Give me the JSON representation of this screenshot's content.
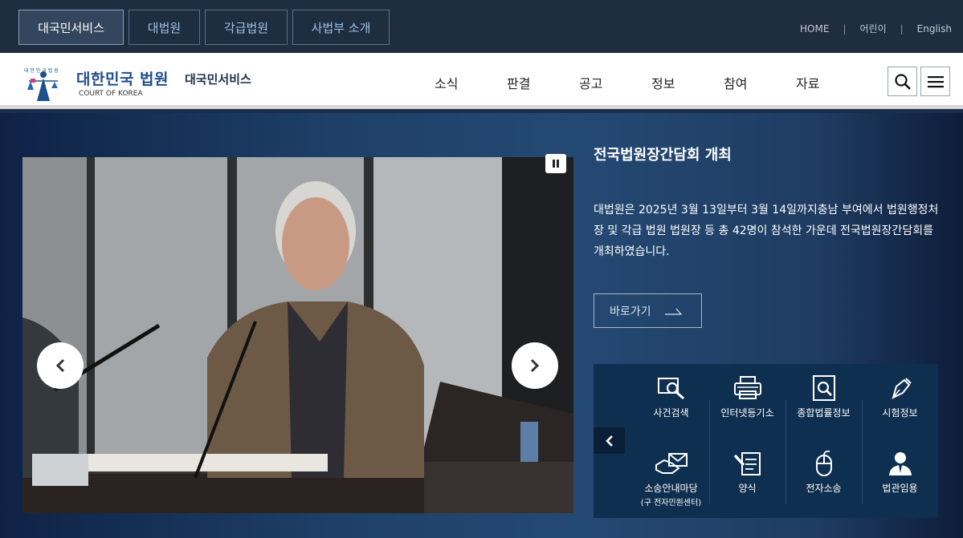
{
  "top_tabs": [
    {
      "label": "대국민서비스"
    },
    {
      "label": "대법원"
    },
    {
      "label": "각급법원"
    },
    {
      "label": "사법부 소개"
    }
  ],
  "top_links": [
    "HOME",
    "어린이",
    "English"
  ],
  "logo": {
    "emblem_text": "대한민국법원",
    "title": "대한민국 법원",
    "subtitle": "COURT OF KOREA",
    "service": "대국민서비스"
  },
  "gnb": [
    "소식",
    "판결",
    "공고",
    "정보",
    "참여",
    "자료"
  ],
  "icons": {
    "search": "search-icon",
    "menu": "menu-icon"
  },
  "slide": {
    "title": "전국법원장간담회 개최",
    "description": "대법원은 2025년 3월 13일부터 3월 14일까지충남 부여에서 법원행정처장 및 각급 법원 법원장 등 총 42명이 참석한 가운데 전국법원장간담회를 개최하였습니다.",
    "go_label": "바로가기"
  },
  "quick_menu": [
    {
      "label": "사건검색",
      "icon": "magnifier-monitor-icon"
    },
    {
      "label": "인터넷등기소",
      "icon": "printer-icon"
    },
    {
      "label": "종합법률정보",
      "icon": "book-search-icon"
    },
    {
      "label": "시험정보",
      "icon": "pen-nib-icon"
    },
    {
      "label": "소송안내마당",
      "sub": "(구 전자민원센터)",
      "icon": "handshake-mail-icon"
    },
    {
      "label": "양식",
      "icon": "form-pencil-icon"
    },
    {
      "label": "전자소송",
      "icon": "mouse-icon"
    },
    {
      "label": "법관임용",
      "icon": "judge-person-icon"
    }
  ],
  "colors": {
    "top_bar": "#1e2d40",
    "brand_blue": "#1f4e8c",
    "quick_bg": "#0e2f4f"
  }
}
